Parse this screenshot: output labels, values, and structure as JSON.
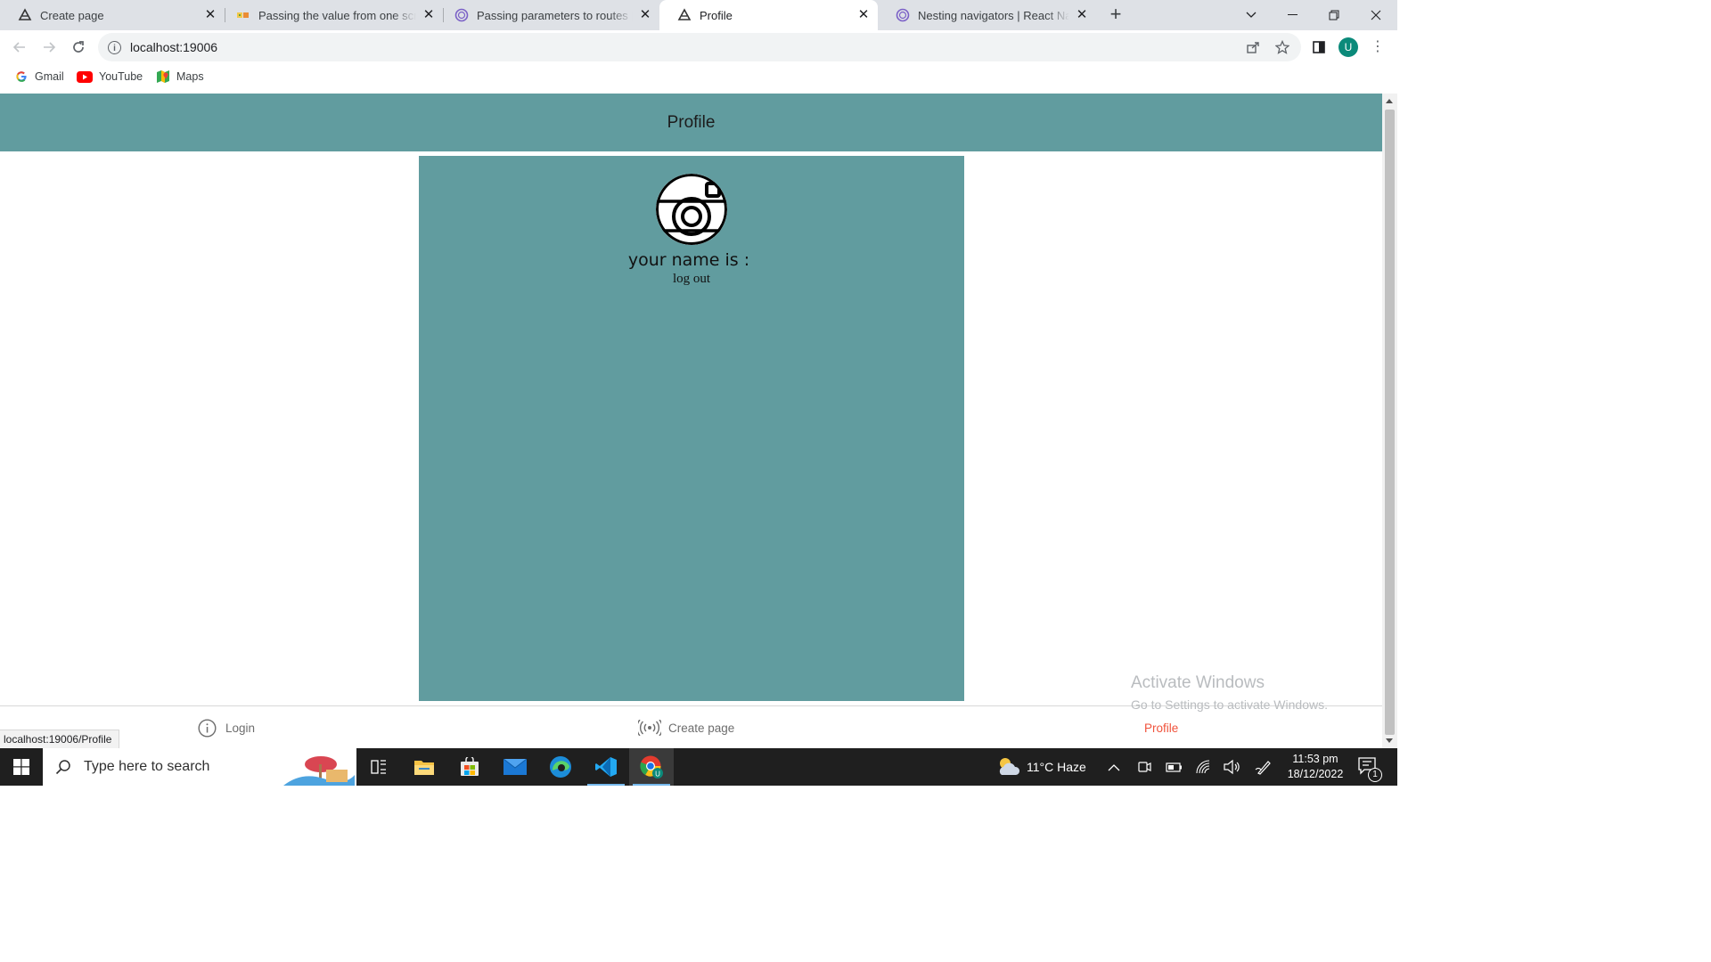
{
  "browser": {
    "tabs": [
      {
        "title": "Create page",
        "icon": "expo-icon",
        "active": false
      },
      {
        "title": "Passing the value from one scree",
        "icon": "stackoverflow-multicolor-icon",
        "active": false
      },
      {
        "title": "Passing parameters to routes | Re",
        "icon": "react-navigation-icon",
        "active": false
      },
      {
        "title": "Profile",
        "icon": "expo-icon",
        "active": true
      },
      {
        "title": "Nesting navigators | React Navig",
        "icon": "react-navigation-icon",
        "active": false
      }
    ],
    "url": "localhost:19006",
    "bookmarks": [
      {
        "label": "Gmail",
        "icon": "google-g-icon"
      },
      {
        "label": "YouTube",
        "icon": "youtube-icon"
      },
      {
        "label": "Maps",
        "icon": "maps-icon"
      }
    ],
    "profile_initial": "U",
    "status_url": "localhost:19006/Profile"
  },
  "app": {
    "header_title": "Profile",
    "name_label": "your name is :",
    "logout_label": "log out",
    "bottom_tabs": [
      {
        "label": "Login",
        "icon": "info-circle-icon",
        "active": false
      },
      {
        "label": "Create page",
        "icon": "broadcast-icon",
        "active": false
      },
      {
        "label": "Profile",
        "icon": "",
        "active": true
      }
    ],
    "colors": {
      "header_bg": "#619c9f",
      "card_bg": "#619c9f",
      "active_tab": "#f0533c"
    }
  },
  "watermark": {
    "line1": "Activate Windows",
    "line2": "Go to Settings to activate Windows."
  },
  "taskbar": {
    "search_placeholder": "Type here to search",
    "weather": "11°C  Haze",
    "time": "11:53 pm",
    "date": "18/12/2022",
    "notification_count": "1"
  }
}
